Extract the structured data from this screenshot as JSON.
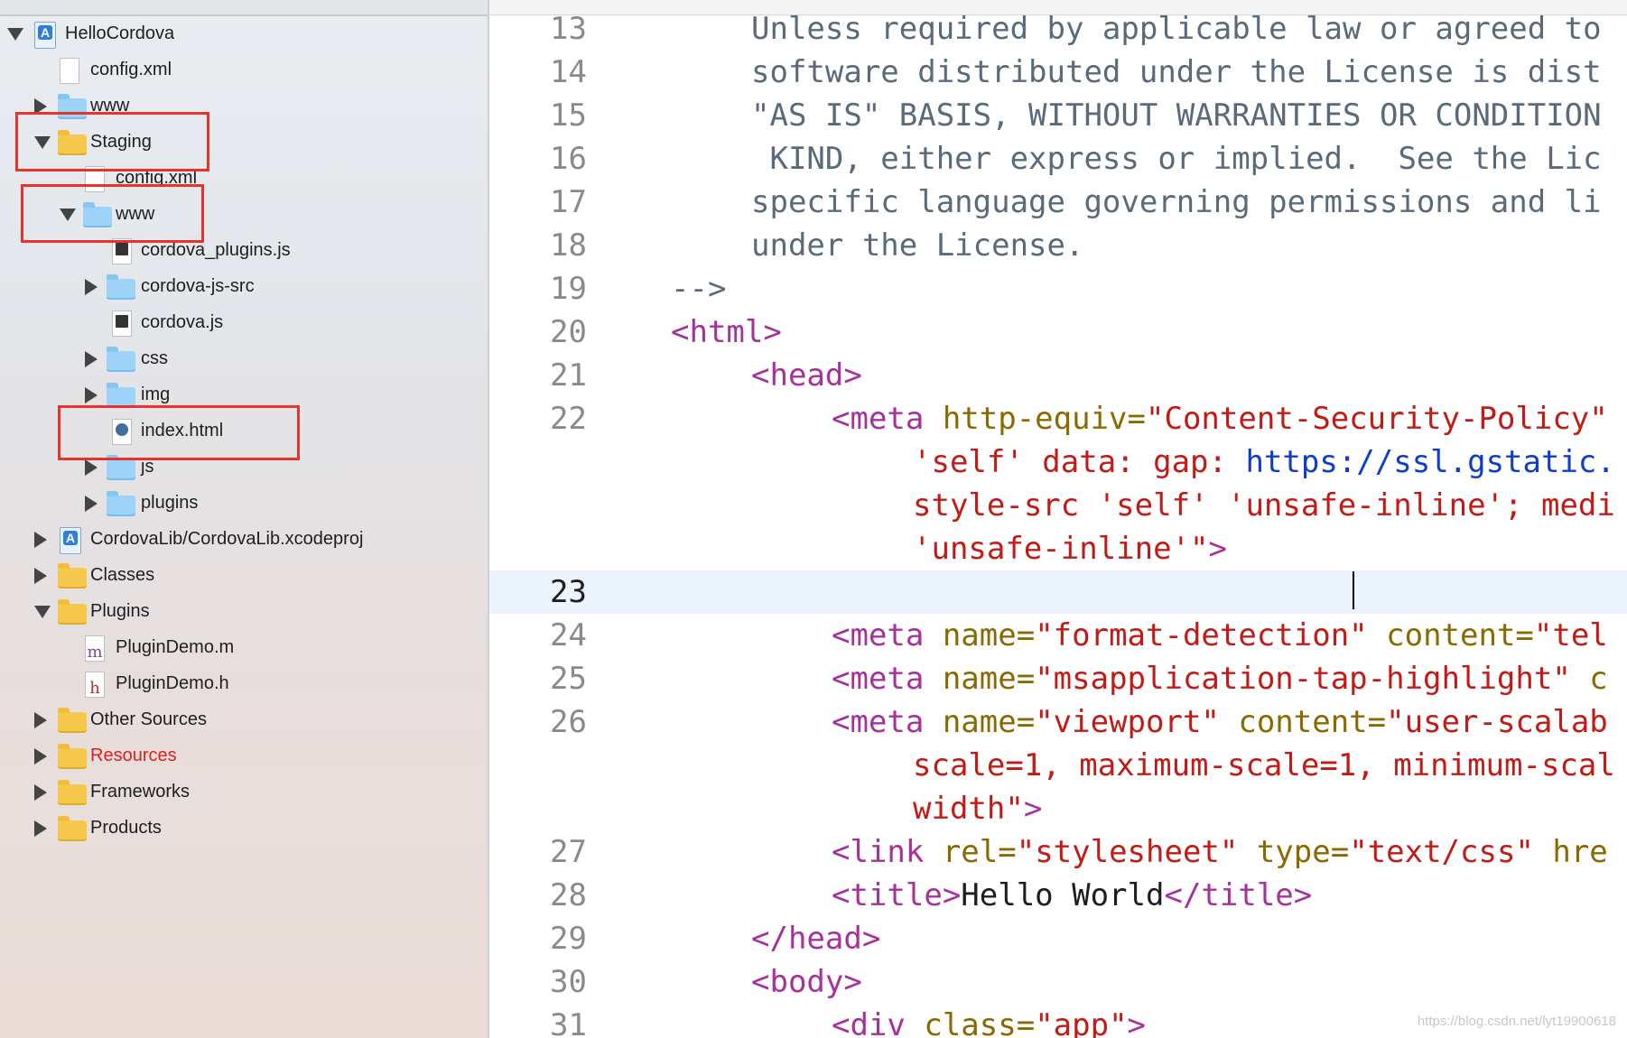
{
  "navigator": {
    "items": [
      {
        "label": "HelloCordova",
        "icon": "xcode-project-icon",
        "disclosure": "expanded",
        "red": false
      },
      {
        "label": "config.xml",
        "icon": "file-icon",
        "disclosure": "none",
        "red": false
      },
      {
        "label": "www",
        "icon": "folder-icon",
        "disclosure": "collapsed",
        "red": false
      },
      {
        "label": "Staging",
        "icon": "folder-icon",
        "disclosure": "expanded",
        "red": false
      },
      {
        "label": "config.xml",
        "icon": "file-icon",
        "disclosure": "none",
        "red": false
      },
      {
        "label": "www",
        "icon": "folder-icon",
        "disclosure": "expanded",
        "red": false
      },
      {
        "label": "cordova_plugins.js",
        "icon": "js-file-icon",
        "disclosure": "none",
        "red": false
      },
      {
        "label": "cordova-js-src",
        "icon": "folder-icon",
        "disclosure": "collapsed",
        "red": false
      },
      {
        "label": "cordova.js",
        "icon": "js-file-icon",
        "disclosure": "none",
        "red": false
      },
      {
        "label": "css",
        "icon": "folder-icon",
        "disclosure": "collapsed",
        "red": false
      },
      {
        "label": "img",
        "icon": "folder-icon",
        "disclosure": "collapsed",
        "red": false
      },
      {
        "label": "index.html",
        "icon": "html-file-icon",
        "disclosure": "none",
        "red": false
      },
      {
        "label": "js",
        "icon": "folder-icon",
        "disclosure": "collapsed",
        "red": false
      },
      {
        "label": "plugins",
        "icon": "folder-icon",
        "disclosure": "collapsed",
        "red": false
      },
      {
        "label": "CordovaLib/CordovaLib.xcodeproj",
        "icon": "xcode-project-icon",
        "disclosure": "collapsed",
        "red": false
      },
      {
        "label": "Classes",
        "icon": "folder-icon",
        "disclosure": "collapsed",
        "red": false
      },
      {
        "label": "Plugins",
        "icon": "folder-icon",
        "disclosure": "expanded",
        "red": false
      },
      {
        "label": "PluginDemo.m",
        "icon": "m-file-icon",
        "disclosure": "none",
        "red": false
      },
      {
        "label": "PluginDemo.h",
        "icon": "h-file-icon",
        "disclosure": "none",
        "red": false
      },
      {
        "label": "Other Sources",
        "icon": "folder-icon",
        "disclosure": "collapsed",
        "red": false
      },
      {
        "label": "Resources",
        "icon": "folder-icon",
        "disclosure": "collapsed",
        "red": true
      },
      {
        "label": "Frameworks",
        "icon": "folder-icon",
        "disclosure": "collapsed",
        "red": false
      },
      {
        "label": "Products",
        "icon": "folder-icon",
        "disclosure": "collapsed",
        "red": false
      }
    ],
    "m_glyph": "m",
    "h_glyph": "h"
  },
  "editor": {
    "current_line": "23",
    "lines": [
      {
        "num": "13",
        "tokens": [
          {
            "t": "Unless required by applicable law or agreed to",
            "c": "comment"
          }
        ]
      },
      {
        "num": "14",
        "tokens": [
          {
            "t": "software distributed under the License is dist",
            "c": "comment"
          }
        ]
      },
      {
        "num": "15",
        "tokens": [
          {
            "t": "\"AS IS\" BASIS, WITHOUT WARRANTIES OR CONDITION",
            "c": "comment"
          }
        ]
      },
      {
        "num": "16",
        "tokens": [
          {
            "t": " KIND, either express or implied.  See the Lic",
            "c": "comment"
          }
        ]
      },
      {
        "num": "17",
        "tokens": [
          {
            "t": "specific language governing permissions and li",
            "c": "comment"
          }
        ]
      },
      {
        "num": "18",
        "tokens": [
          {
            "t": "under the License.",
            "c": "comment"
          }
        ]
      },
      {
        "num": "19",
        "tokens": [
          {
            "t": "-->",
            "c": "comment"
          }
        ]
      },
      {
        "num": "20",
        "tokens": [
          {
            "t": "<html>",
            "c": "tag"
          }
        ]
      },
      {
        "num": "21",
        "tokens": [
          {
            "t": "<head>",
            "c": "tag"
          }
        ]
      },
      {
        "num": "22",
        "tokens": [
          {
            "t": "<meta ",
            "c": "tag"
          },
          {
            "t": "http-equiv=",
            "c": "attr"
          },
          {
            "t": "\"Content-Security-Policy\"",
            "c": "str"
          }
        ]
      },
      {
        "num": "",
        "tokens": [
          {
            "t": "'self' data: gap: ",
            "c": "str"
          },
          {
            "t": "https://ssl.gstatic.",
            "c": "url"
          }
        ]
      },
      {
        "num": "",
        "tokens": [
          {
            "t": "style-src 'self' 'unsafe-inline'; medi",
            "c": "str"
          }
        ]
      },
      {
        "num": "",
        "tokens": [
          {
            "t": "'unsafe-inline'\"",
            "c": "str"
          },
          {
            "t": ">",
            "c": "tag"
          }
        ]
      },
      {
        "num": "23",
        "tokens": []
      },
      {
        "num": "24",
        "tokens": [
          {
            "t": "<meta ",
            "c": "tag"
          },
          {
            "t": "name=",
            "c": "attr"
          },
          {
            "t": "\"format-detection\" ",
            "c": "str"
          },
          {
            "t": "content=",
            "c": "attr"
          },
          {
            "t": "\"tel",
            "c": "str"
          }
        ]
      },
      {
        "num": "25",
        "tokens": [
          {
            "t": "<meta ",
            "c": "tag"
          },
          {
            "t": "name=",
            "c": "attr"
          },
          {
            "t": "\"msapplication-tap-highlight\" ",
            "c": "str"
          },
          {
            "t": "c",
            "c": "attr"
          }
        ]
      },
      {
        "num": "26",
        "tokens": [
          {
            "t": "<meta ",
            "c": "tag"
          },
          {
            "t": "name=",
            "c": "attr"
          },
          {
            "t": "\"viewport\" ",
            "c": "str"
          },
          {
            "t": "content=",
            "c": "attr"
          },
          {
            "t": "\"user-scalab",
            "c": "str"
          }
        ]
      },
      {
        "num": "",
        "tokens": [
          {
            "t": "scale=1, maximum-scale=1, minimum-scal",
            "c": "str"
          }
        ]
      },
      {
        "num": "",
        "tokens": [
          {
            "t": "width\"",
            "c": "str"
          },
          {
            "t": ">",
            "c": "tag"
          }
        ]
      },
      {
        "num": "27",
        "tokens": [
          {
            "t": "<link ",
            "c": "tag"
          },
          {
            "t": "rel=",
            "c": "attr"
          },
          {
            "t": "\"stylesheet\" ",
            "c": "str"
          },
          {
            "t": "type=",
            "c": "attr"
          },
          {
            "t": "\"text/css\" ",
            "c": "str"
          },
          {
            "t": "hre",
            "c": "attr"
          }
        ]
      },
      {
        "num": "28",
        "tokens": [
          {
            "t": "<title>",
            "c": "tag"
          },
          {
            "t": "Hello World",
            "c": "plain"
          },
          {
            "t": "</title>",
            "c": "tag"
          }
        ]
      },
      {
        "num": "29",
        "tokens": [
          {
            "t": "</head>",
            "c": "tag"
          }
        ]
      },
      {
        "num": "30",
        "tokens": [
          {
            "t": "<body>",
            "c": "tag"
          }
        ]
      },
      {
        "num": "31",
        "tokens": [
          {
            "t": "<div ",
            "c": "tag"
          },
          {
            "t": "class=",
            "c": "attr"
          },
          {
            "t": "\"app\"",
            "c": "str"
          },
          {
            "t": ">",
            "c": "tag"
          }
        ]
      }
    ]
  },
  "watermark": "https://blog.csdn.net/lyt19900618",
  "colors": {
    "highlight_box": "#e8322c",
    "comment": "#5a6a7a",
    "tag": "#a8309a",
    "attr": "#8a6a00",
    "string": "#c41a16",
    "url": "#0e3ccd",
    "resources_label": "#e01e1e"
  }
}
